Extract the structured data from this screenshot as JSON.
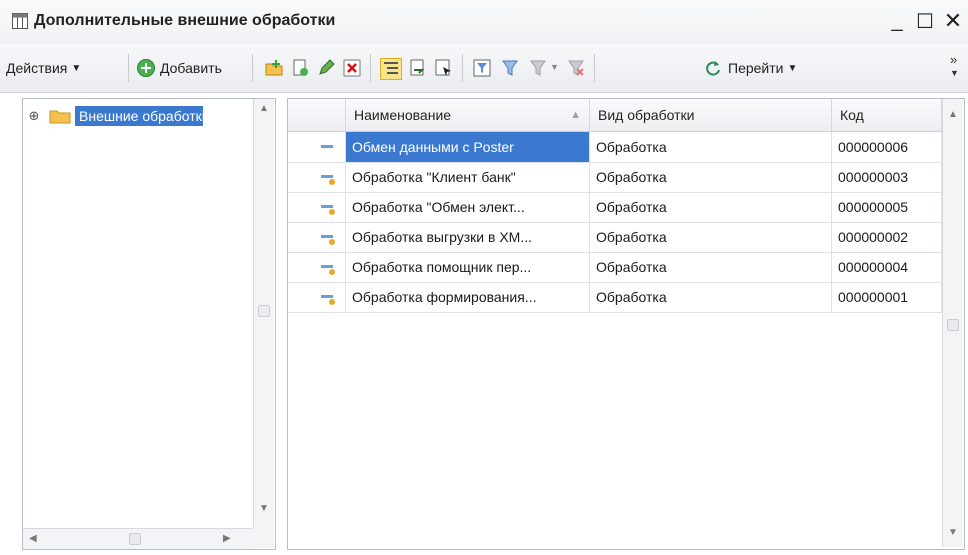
{
  "window": {
    "title": "Дополнительные внешние обработки",
    "min": "_",
    "max": "☐",
    "close": "✕"
  },
  "toolbar": {
    "actions_label": "Действия",
    "add_label": "Добавить",
    "goto_label": "Перейти",
    "overflow": "»"
  },
  "tree": {
    "expand": "⊕",
    "root_label": "Внешние обработки"
  },
  "table": {
    "columns": [
      "Наименование",
      "Вид обработки",
      "Код"
    ],
    "rows": [
      {
        "name": "Обмен данными с Poster",
        "type": "Обработка",
        "code": "000000006"
      },
      {
        "name": "Обработка \"Клиент банк\"",
        "type": "Обработка",
        "code": "000000003"
      },
      {
        "name": "Обработка \"Обмен элект...",
        "type": "Обработка",
        "code": "000000005"
      },
      {
        "name": "Обработка выгрузки в XM...",
        "type": "Обработка",
        "code": "000000002"
      },
      {
        "name": "Обработка помощник пер...",
        "type": "Обработка",
        "code": "000000004"
      },
      {
        "name": "Обработка формирования...",
        "type": "Обработка",
        "code": "000000001"
      }
    ]
  },
  "colors": {
    "selection": "#3b79d0",
    "toolbar_bg": "#e9ecef"
  }
}
